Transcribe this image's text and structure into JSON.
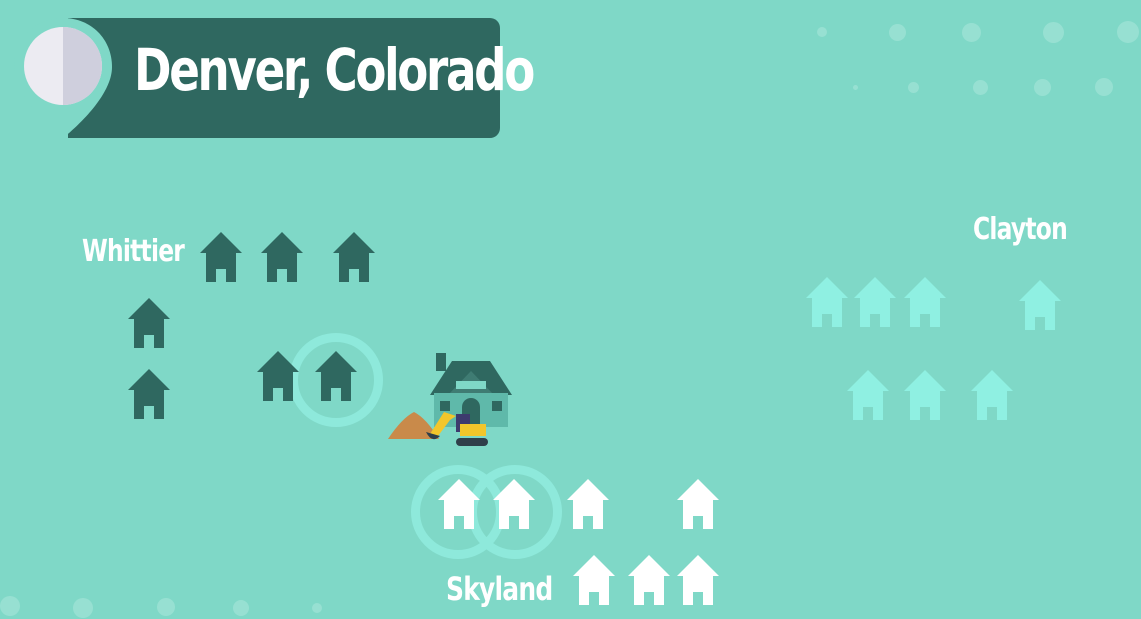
{
  "title": "Denver, Colorado",
  "neighborhoods": {
    "whittier": "Whittier",
    "clayton": "Clayton",
    "skyland": "Skyland"
  },
  "icons": {
    "location_pin": "map-pin-icon",
    "house": "house-icon",
    "large_house": "large-house-icon",
    "excavator": "excavator-icon",
    "dirt_pile": "dirt-pile-icon"
  },
  "colors": {
    "background": "#7fd8c7",
    "banner": "#2f6860",
    "whittier_house": "#2f6860",
    "clayton_house": "#8ff0e2",
    "skyland_house": "#ffffff",
    "highlight_ring": "#8ee9db"
  }
}
